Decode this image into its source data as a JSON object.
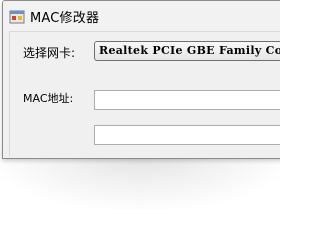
{
  "window": {
    "title": "MAC修改器",
    "icon": "app-window-icon"
  },
  "form": {
    "adapter_label": "选择网卡:",
    "adapter_selected": "Realtek PCIe GBE Family Controller",
    "mac_label": "MAC地址:",
    "mac_value": "",
    "new_mac_value": ""
  },
  "colors": {
    "window_bg": "#f0f0f0",
    "input_border": "#abadb3",
    "combo_border": "#707070"
  }
}
